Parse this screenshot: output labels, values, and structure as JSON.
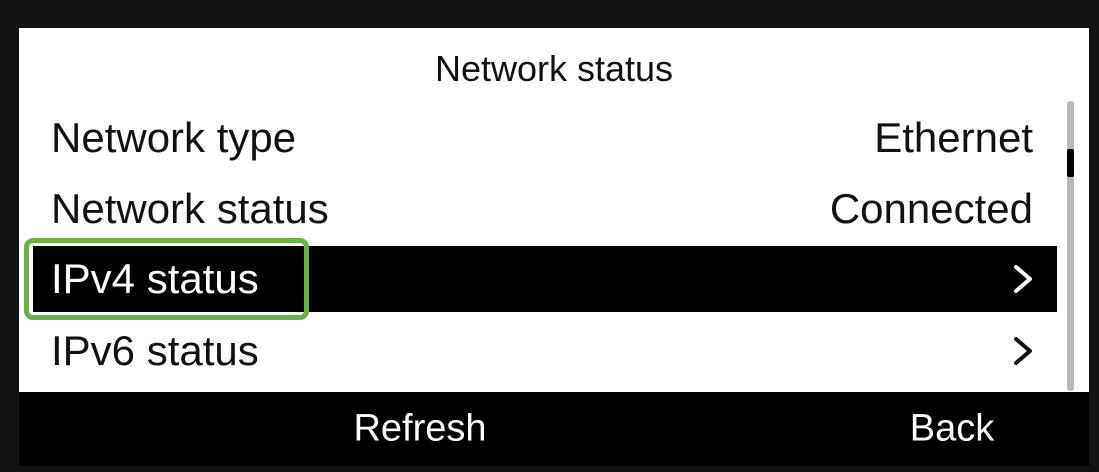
{
  "screen": {
    "title": "Network status"
  },
  "rows": [
    {
      "label": "Network type",
      "value": "Ethernet"
    },
    {
      "label": "Network status",
      "value": "Connected"
    },
    {
      "label": "IPv4 status",
      "value": ""
    },
    {
      "label": "IPv6 status",
      "value": ""
    }
  ],
  "softkeys": {
    "refresh": "Refresh",
    "back": "Back"
  },
  "colors": {
    "highlight": "#67b346",
    "selected_row": "#000000",
    "softkey_bar": "#000000"
  },
  "icons": {
    "chevron": "chevron-right-icon"
  }
}
